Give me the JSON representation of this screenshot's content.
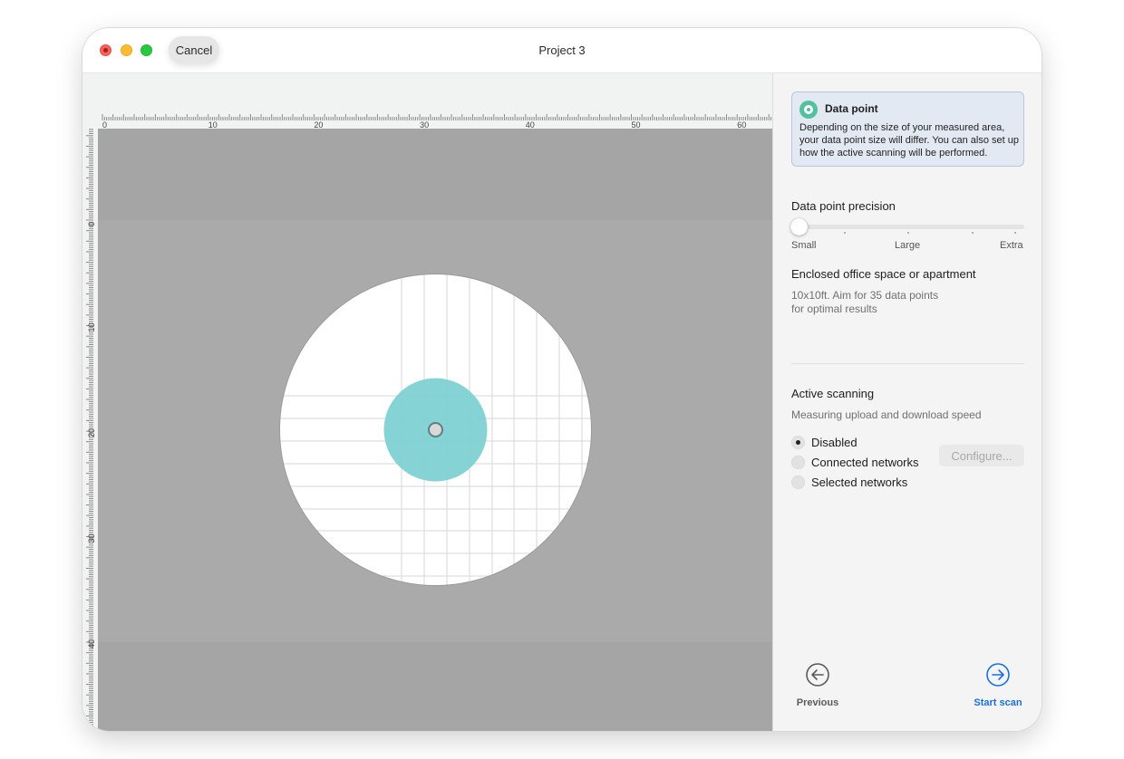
{
  "window": {
    "title": "Project 3",
    "cancel_label": "Cancel"
  },
  "rulers": {
    "horizontal_labels": [
      "0",
      "10",
      "20",
      "30",
      "40",
      "50",
      "60"
    ],
    "vertical_labels": [
      "0",
      "10",
      "20",
      "30",
      "40"
    ]
  },
  "info_card": {
    "icon": "data-point-icon",
    "title": "Data point",
    "body": "Depending on the size of your measured area, your data point size will differ. You can also set up how the active scanning will be performed."
  },
  "precision": {
    "title": "Data point precision",
    "labels": [
      "Small",
      "Large",
      "Extra"
    ],
    "selected": "Small"
  },
  "area": {
    "title": "Enclosed office space or apartment",
    "line1": "10x10ft. Aim for 35 data points",
    "line2": "for optimal results"
  },
  "scanning": {
    "title": "Active scanning",
    "subtitle": "Measuring upload and download speed",
    "options": [
      {
        "label": "Disabled",
        "checked": true
      },
      {
        "label": "Connected networks",
        "checked": false
      },
      {
        "label": "Selected networks",
        "checked": false
      }
    ],
    "configure_label": "Configure..."
  },
  "navigation": {
    "previous_label": "Previous",
    "start_label": "Start scan"
  },
  "colors": {
    "accent": "#1a6fe0",
    "data_point": "#52c19d",
    "coverage": "#7fd1d3",
    "plan_background": "#a5a5a5"
  }
}
